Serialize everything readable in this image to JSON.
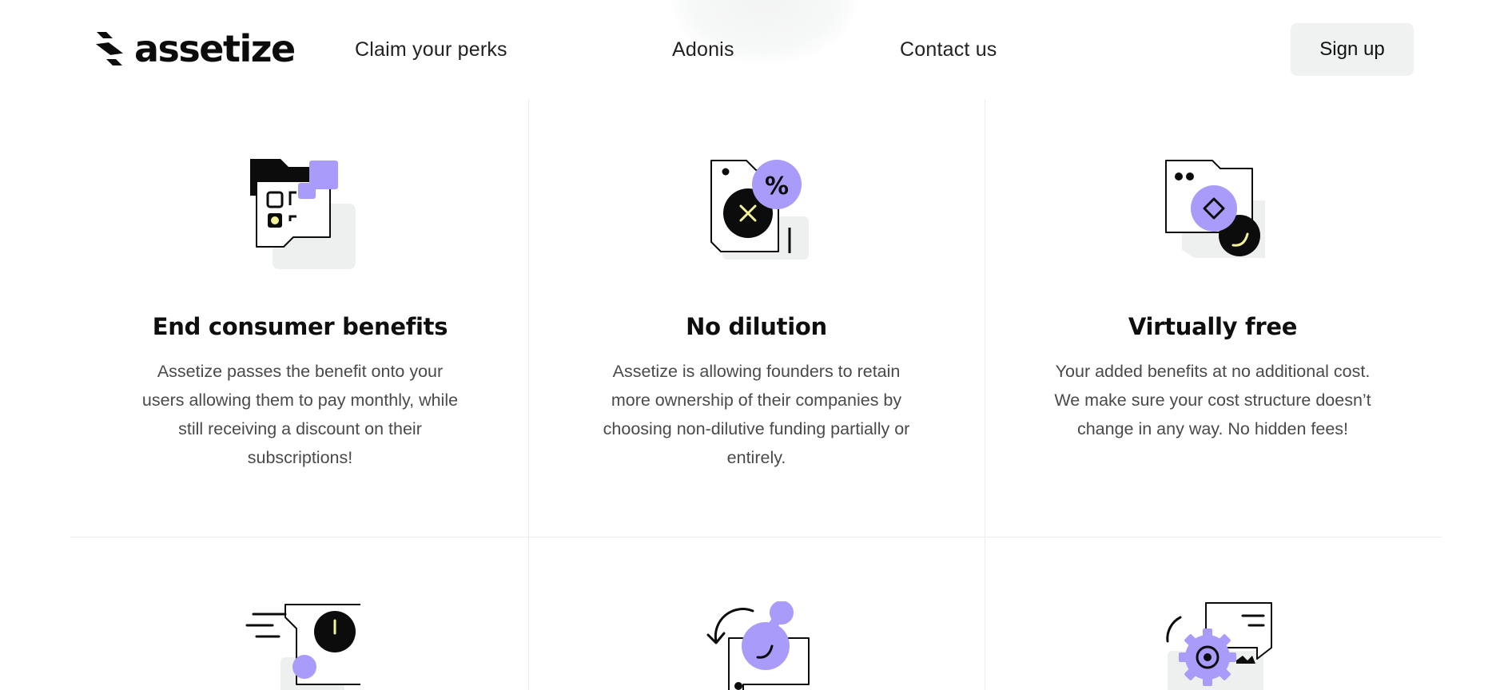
{
  "header": {
    "logo_text": "assetize",
    "nav": [
      {
        "label": "Claim your perks"
      },
      {
        "label": "Adonis"
      },
      {
        "label": "Contact us"
      }
    ],
    "signup_label": "Sign up"
  },
  "colors": {
    "accent_purple": "#a99bf9",
    "accent_yellow": "#f4f29a",
    "ink": "#0c0c0c",
    "muted_gray": "#eef0ef"
  },
  "features": [
    {
      "icon": "qr-folder-icon",
      "title": "End consumer benefits",
      "description": "Assetize passes the benefit onto your users allowing them to pay monthly, while still receiving a discount on their subscriptions!"
    },
    {
      "icon": "percent-card-icon",
      "title": "No dilution",
      "description": "Assetize is allowing founders to retain more ownership of their companies by choosing non-dilutive funding partially or entirely."
    },
    {
      "icon": "diamond-window-icon",
      "title": "Virtually free",
      "description": "Your added benefits at no additional cost. We make sure your cost structure doesn’t change in any way. No hidden fees!"
    },
    {
      "icon": "clock-speed-icon"
    },
    {
      "icon": "refresh-card-icon"
    },
    {
      "icon": "gear-chat-icon"
    }
  ]
}
